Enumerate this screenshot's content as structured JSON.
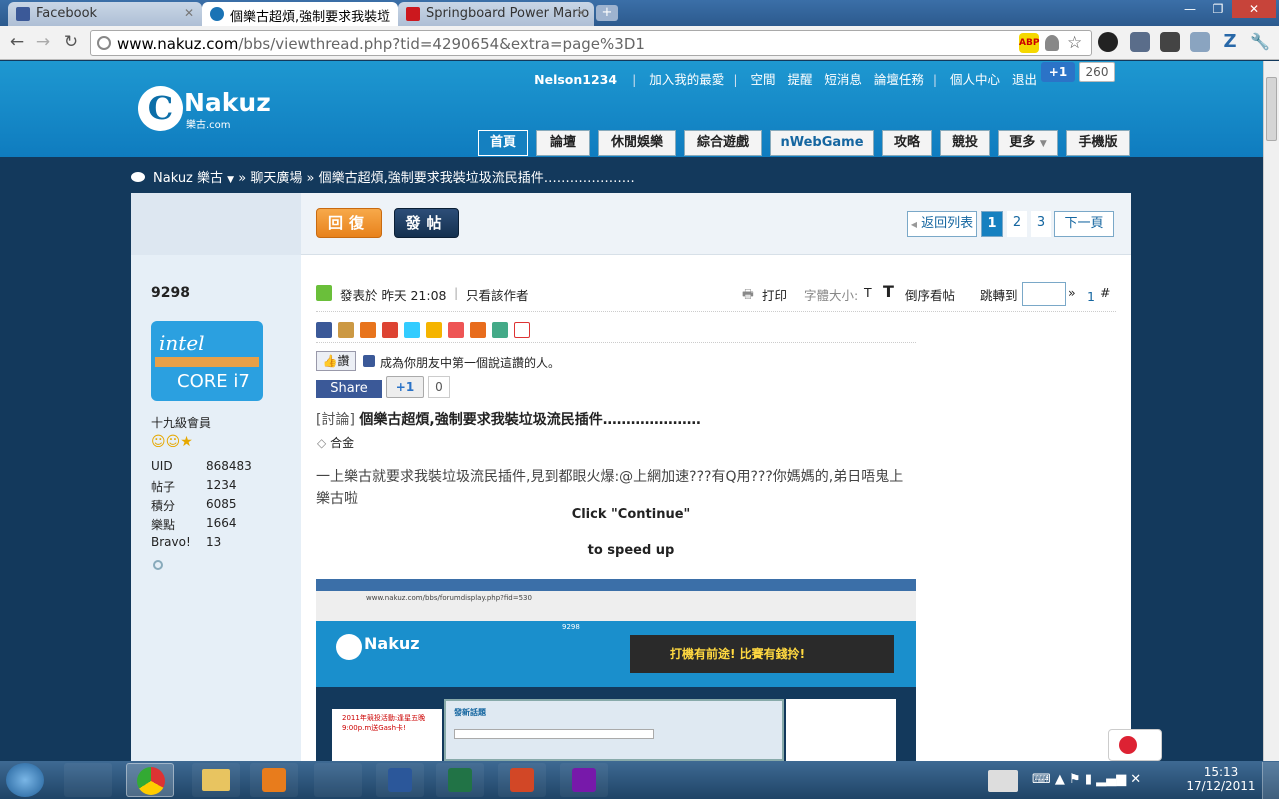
{
  "browser": {
    "tabs": [
      {
        "label": "Facebook",
        "active": false,
        "icon_color": "#3b5998"
      },
      {
        "label": "個樂古超煩,強制要求我裝垃",
        "active": true,
        "icon_color": "#1a73b5"
      },
      {
        "label": "Springboard Power Mario",
        "active": false,
        "icon_color": "#cc181e"
      }
    ],
    "new_tab": "+",
    "window_controls": {
      "minimize": "—",
      "maximize": "❐",
      "close": "✕"
    },
    "url_host": "www.nakuz.com",
    "url_rest": "/bbs/viewthread.php?tid=4290654&extra=page%3D1",
    "extensions": [
      "ABP",
      "Z"
    ]
  },
  "header": {
    "username": "Nelson1234",
    "links": [
      "加入我的最愛",
      "空間",
      "提醒",
      "短消息",
      "論壇任務",
      "個人中心",
      "退出"
    ],
    "gplus_label": "+1",
    "gplus_count": "260",
    "logo_letter": "C",
    "logo_name": "Nakuz",
    "logo_sub": "樂古.com"
  },
  "nav": [
    "首頁",
    "論壇",
    "休閒娛樂",
    "綜合遊戲",
    "nWebGame",
    "攻略",
    "競投",
    "更多",
    "手機版"
  ],
  "breadcrumb": {
    "site": "Nakuz 樂古",
    "sep1": "»",
    "forum": "聊天廣場",
    "sep2": "»",
    "thread": "個樂古超煩,強制要求我裝垃圾流民插件…………………"
  },
  "actions": {
    "reply": "回復",
    "post": "發帖"
  },
  "pagination": {
    "back": "返回列表",
    "pages": [
      "1",
      "2",
      "3"
    ],
    "current": "1",
    "next": "下一頁"
  },
  "user": {
    "name": "9298",
    "rank": "十九級會員",
    "stats": [
      {
        "k": "UID",
        "v": "868483"
      },
      {
        "k": "帖子",
        "v": "1234"
      },
      {
        "k": "積分",
        "v": "6085"
      },
      {
        "k": "樂點",
        "v": "1664"
      },
      {
        "k": "Bravo!",
        "v": "13"
      }
    ],
    "avatar_text1": "intel",
    "avatar_text2": "CORE i7"
  },
  "post": {
    "posted": "發表於 昨天 21:08",
    "only_author": "只看該作者",
    "print": "打印",
    "font_size": "字體大小:",
    "font_t": "T",
    "reverse": "倒序看帖",
    "jump": "跳轉到",
    "jump_go": "»",
    "floor": "1",
    "floor_hash": "#",
    "like": "讚",
    "like_text": "成為你朋友中第一個說這讚的人。",
    "share": "Share",
    "plus_one": "+1",
    "plus_count": "0",
    "tag": "[討論]",
    "title": "個樂古超煩,強制要求我裝垃圾流民插件…………………",
    "tag_label": "合金",
    "body": "一上樂古就要求我裝垃圾流民插件,見到都眼火爆:@上網加速???有Q用???你媽媽的,弟日唔鬼上樂古啦",
    "overlay1": "Click \"Continue\"",
    "overlay2": "to speed up"
  },
  "embedded": {
    "url": "www.nakuz.com/bbs/forumdisplay.php?fid=530",
    "user": "9298",
    "dialog_title": "發新話題",
    "banner": "打機有前途! 比賽有錢拎!",
    "promo": "2011年競投活動:逢星五晚9:00p.m送Gash卡!"
  },
  "taskbar": {
    "time": "15:13",
    "date": "17/12/2011"
  }
}
